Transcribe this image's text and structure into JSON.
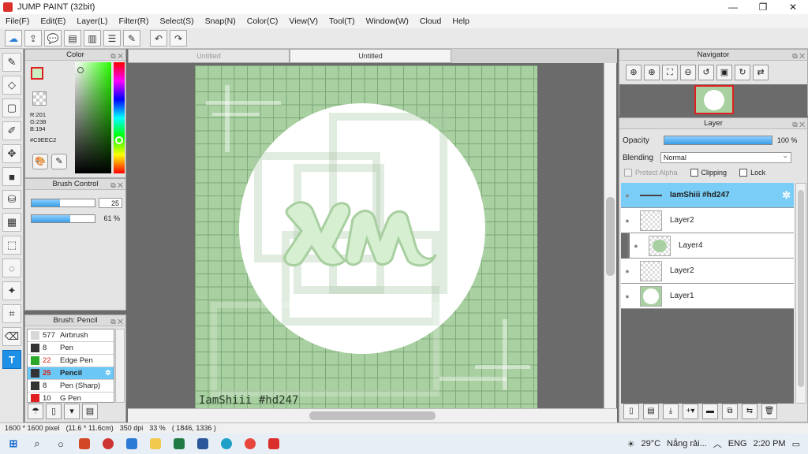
{
  "window": {
    "title": "JUMP PAINT (32bit)",
    "minimize": "—",
    "maximize": "❐",
    "close": "✕"
  },
  "menu": [
    "File(F)",
    "Edit(E)",
    "Layer(L)",
    "Filter(R)",
    "Select(S)",
    "Snap(N)",
    "Color(C)",
    "View(V)",
    "Tool(T)",
    "Window(W)",
    "Cloud",
    "Help"
  ],
  "color_panel": {
    "title": "Color",
    "r": "R:201",
    "g": "G:238",
    "b": "B:194",
    "hex": "#C9EEC2",
    "foreground": "#C9EEC2"
  },
  "brush_control": {
    "title": "Brush Control",
    "size": {
      "value": "25",
      "fraction": 0.45
    },
    "opacity": {
      "value": "61 %",
      "fraction": 0.61
    }
  },
  "brush_panel": {
    "title": "Brush: Pencil",
    "items": [
      {
        "size": "577",
        "name": "Airbrush",
        "color": "#d8d8d8"
      },
      {
        "size": "8",
        "name": "Pen",
        "color": "#333333"
      },
      {
        "size": "22",
        "name": "Edge Pen",
        "color": "#2aa82a"
      },
      {
        "size": "25",
        "name": "Pencil",
        "color": "#333333",
        "selected": true
      },
      {
        "size": "8",
        "name": "Pen (Sharp)",
        "color": "#333333"
      },
      {
        "size": "10",
        "name": "G Pen",
        "color": "#e02020"
      }
    ]
  },
  "tabs": [
    "Untitled",
    "Untitled"
  ],
  "canvas": {
    "signature": "IamShiii #hd247",
    "artboard_color": "#A8D0A1"
  },
  "navigator": {
    "title": "Navigator"
  },
  "layer_panel": {
    "title": "Layer",
    "opacity_label": "Opacity",
    "opacity_value": "100 %",
    "blending_label": "Blending",
    "blending_value": "Normal",
    "protect_alpha": "Protect Alpha",
    "clipping": "Clipping",
    "lock": "Lock",
    "layers": [
      {
        "name": "IamShiii #hd247",
        "thumb": "text",
        "selected": true
      },
      {
        "name": "Layer2",
        "thumb": "empty"
      },
      {
        "name": "Layer4",
        "thumb": "green",
        "indent": true
      },
      {
        "name": "Layer2",
        "thumb": "empty"
      },
      {
        "name": "Layer1",
        "thumb": "greenbg"
      }
    ]
  },
  "status": {
    "size": "1600 * 1600 pixel",
    "cm": "(11.6 * 11.6cm)",
    "dpi": "350 dpi",
    "zoom": "33 %",
    "coords": "( 1846, 1336 )"
  },
  "taskbar": {
    "weather": "29°C",
    "weather_text": "Nắng rải...",
    "lang": "ENG",
    "time": "2:20 PM"
  }
}
